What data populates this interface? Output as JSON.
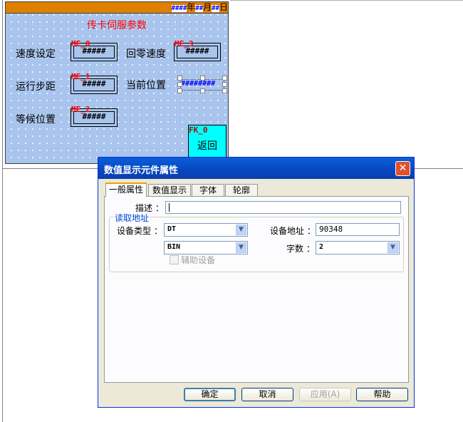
{
  "screen": {
    "date_placeholder_year": "####",
    "year_label": "年",
    "date_placeholder_month": "##",
    "month_label": "月",
    "date_placeholder_day": "##",
    "day_label": "日",
    "title": "传卡伺服参数",
    "fields": [
      {
        "label": "速度设定",
        "tag": "ME_0",
        "value": "#####"
      },
      {
        "label": "回零速度",
        "tag": "ME_3",
        "value": "#####"
      },
      {
        "label": "运行步距",
        "tag": "ME_1",
        "value": "#####"
      },
      {
        "label": "当前位置",
        "value": "########"
      },
      {
        "label": "等候位置",
        "tag": "ME_2",
        "value": "#####"
      }
    ],
    "key": {
      "tag": "FK_0",
      "label": "返回"
    }
  },
  "dialog": {
    "title": "数值显示元件属性",
    "close_symbol": "✕",
    "tabs": [
      "一般属性",
      "数值显示",
      "字体",
      "轮廓"
    ],
    "description_label": "描述 ：",
    "description_value": "",
    "group_title": "读取地址",
    "device_type_label": "设备类型 ：",
    "device_type_value": "DT",
    "device_address_label": "设备地址 ：",
    "device_address_value": "90348",
    "format_value": "BIN",
    "word_count_label": "字数 ：",
    "word_count_value": "2",
    "aux_device_label": "辅助设备",
    "aux_device_checked": false,
    "buttons": {
      "ok": "确定",
      "cancel": "取消",
      "apply": "应用(A)",
      "help": "帮助"
    }
  }
}
